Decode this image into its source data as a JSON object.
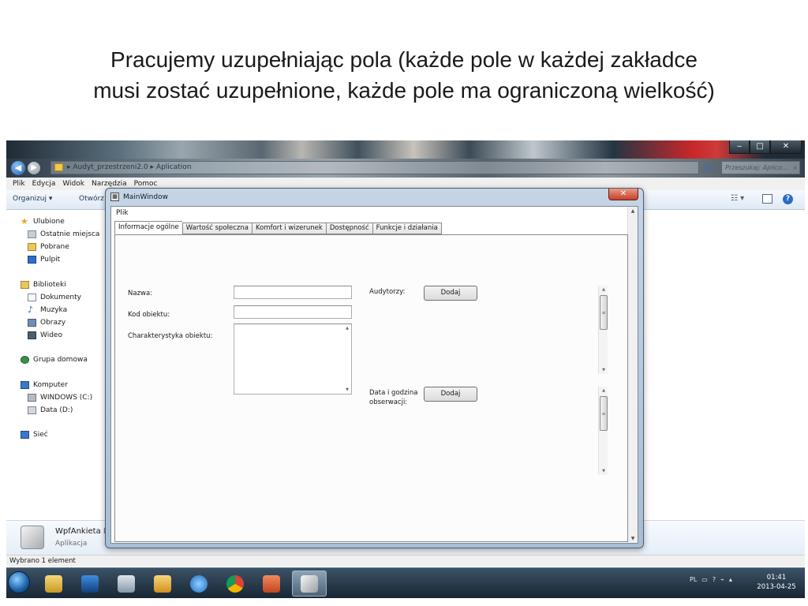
{
  "slide": {
    "title_line1": "Pracujemy uzupełniając pola (każde pole w każdej zakładce",
    "title_line2": "musi zostać uzupełnione, każde pole ma ograniczoną wielkość)"
  },
  "explorer": {
    "breadcrumb": "▸ Audyt_przestrzeni2.0 ▸ Aplication",
    "search_placeholder": "Przeszukaj: Aplico...",
    "menu": [
      "Plik",
      "Edycja",
      "Widok",
      "Narzędzia",
      "Pomoc"
    ],
    "toolbar": {
      "organize_label": "Organizuj ▾",
      "open_label": "Otwórz"
    },
    "nav": {
      "favorites": "Ulubione",
      "recent": "Ostatnie miejsca",
      "downloads": "Pobrane",
      "desktop": "Pulpit",
      "libraries": "Biblioteki",
      "documents": "Dokumenty",
      "music": "Muzyka",
      "pictures": "Obrazy",
      "videos": "Wideo",
      "homegroup": "Grupa domowa",
      "computer": "Komputer",
      "drive_c": "WINDOWS (C:)",
      "drive_d": "Data (D:)",
      "network": "Sieć"
    },
    "details": {
      "name": "WpfAnkieta",
      "name_suffix": "Da",
      "type": "Aplikacja"
    },
    "status": "Wybrano 1 element"
  },
  "wpf": {
    "title": "MainWindow",
    "menu_file": "Plik",
    "tabs": [
      "Informacje ogólne",
      "Wartość społeczna",
      "Komfort i wizerunek",
      "Dostępność",
      "Funkcje i działania"
    ],
    "active_tab": 0,
    "form": {
      "name_label": "Nazwa:",
      "code_label": "Kod obiektu:",
      "desc_label": "Charakterystyka obiektu:",
      "auditors_label": "Audytorzy:",
      "add_button": "Dodaj",
      "datetime_label_1": "Data i godzina",
      "datetime_label_2": "obserwacji:",
      "add_button_2": "Dodaj",
      "name_value": "",
      "code_value": "",
      "desc_value": ""
    }
  },
  "taskbar": {
    "language": "PL",
    "time": "01:41",
    "date": "2013-04-25"
  },
  "colors": {
    "taskbar": "#1f3142",
    "accent": "#2a6bc8",
    "close_button": "#c5402a"
  }
}
